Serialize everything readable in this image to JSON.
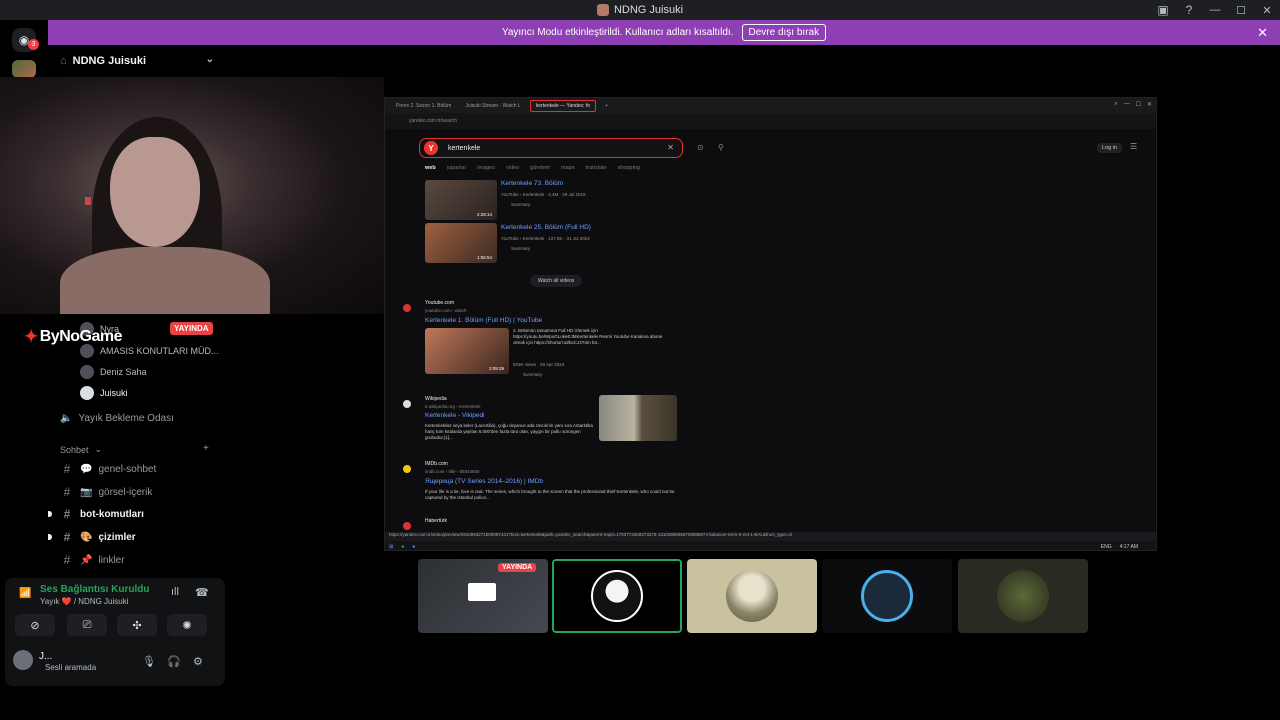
{
  "window": {
    "title": "NDNG Juisuki"
  },
  "banner": {
    "text": "Yayıncı Modu etkinleştirildi. Kullanıcı adları kısaltıldı.",
    "button": "Devre dışı bırak"
  },
  "rail": {
    "badge": "3"
  },
  "server": {
    "name": "NDNG Juisuki"
  },
  "stream_overlay": {
    "brand": "ByNoGame",
    "live_badge": "YAYINDA"
  },
  "voice_users": [
    {
      "name": "Nyra"
    },
    {
      "name": "AMASIS KONUTLARI MÜD..."
    },
    {
      "name": "Deniz Saha"
    },
    {
      "name": "Juisuki"
    }
  ],
  "channels": {
    "afk": "Yayık Bekleme Odası",
    "category": "Sohbet",
    "items": [
      {
        "label": "genel-sohbet",
        "prefix": "💬",
        "active": false
      },
      {
        "label": "görsel-içerik",
        "prefix": "📷",
        "active": false
      },
      {
        "label": "bot-komutları",
        "prefix": "",
        "active": true
      },
      {
        "label": "çizimler",
        "prefix": "🎨",
        "active": true
      },
      {
        "label": "linkler",
        "prefix": "📌",
        "active": false
      }
    ]
  },
  "voice_panel": {
    "status": "Ses Bağlantısı Kuruldu",
    "location": "Yayık ❤️ / NDNG Juisuki",
    "user_name": "J...",
    "user_status": "Sesli aramada"
  },
  "browser": {
    "tabs": [
      "Prens 2. Sezon 1. Bölüm",
      "Juisuki Stream - Watch L",
      "kertenkele — Yandex: fo"
    ],
    "url": "yandex.com.tr/search",
    "query": "kertenkele",
    "search_tabs": [
      "web",
      "yazarlar",
      "images",
      "video",
      "gündem",
      "maps",
      "translate",
      "shopping"
    ],
    "login": "Log in",
    "video_results": [
      {
        "title": "Kertenkele 73. Bölüm",
        "meta": "YouTube › Kertenkele · 4,4M · 29 Jul 2018",
        "duration": "2:28:14",
        "summary": "Summary"
      },
      {
        "title": "Kertenkele 25. Bölüm (Full HD)",
        "meta": "YouTube › Kertenkele · 127,9K · 31 Jul 2024",
        "duration": "1:56:54",
        "summary": "Summary"
      }
    ],
    "watch_all": "Watch all videos",
    "results": [
      {
        "site": "Youtube.com",
        "url": "youtube.com › watch",
        "title": "Kertenkele 1. Bölüm (Full HD) | YouTube",
        "text": "2. Bölümün tamamına Full HD izlemek için https://youtu.be/WpoGLokeEJMKertenkele Resmi Youtube Kanalına abone olmak için https://shorturl.at/bxCJ4Tüm bö...",
        "meta": "503K views · 28 Apr 2024",
        "duration": "2:09:29",
        "summary": "Summary"
      },
      {
        "site": "Wikipedia",
        "url": "tr.wikipedia.org › Kertenkele",
        "title": "Kertenkele - Vikipedi",
        "text": "Kertenkeleler veya keler (Lacertilia), çoğu okyanus ada zincirinin yanı sıra Antarktika hariç tüm kıtalarda yayılan 6.000'den fazla türü olan, yaygın bir pullu sürüngen grubudur.[1]..."
      },
      {
        "site": "IMDb.com",
        "url": "imdb.com › title › tt5843658",
        "title": "Ящерица (TV Series 2014–2016) | IMDb",
        "text": "If your life is a lie, love is real. The series, which brought to the screen that the professional thief Kertenkele, who could not be captured by the Istanbul police..."
      },
      {
        "site": "Habertürk",
        "url": "",
        "title": "",
        "text": ""
      }
    ],
    "status_url": "https://yandex.com.tr/video/preview/2910993271509087431?text=kertenkele&path=yandex_search&parent-reqid=1763774269373275-13103965958709085874-balancer-term-tr-ext-1-BAL&from_type=xl",
    "taskbar": {
      "lang": "ENG",
      "time": "4:17 AM"
    }
  },
  "tiles": [
    {
      "name": "screen-share",
      "live": "YAYINDA"
    },
    {
      "name": "speaking-user"
    },
    {
      "name": "user-3"
    },
    {
      "name": "user-4"
    },
    {
      "name": "user-5"
    }
  ],
  "colors": {
    "accent": "#23a55a",
    "banner": "#8e3fb4",
    "live": "#ed4245",
    "search_red": "#dd3333"
  }
}
